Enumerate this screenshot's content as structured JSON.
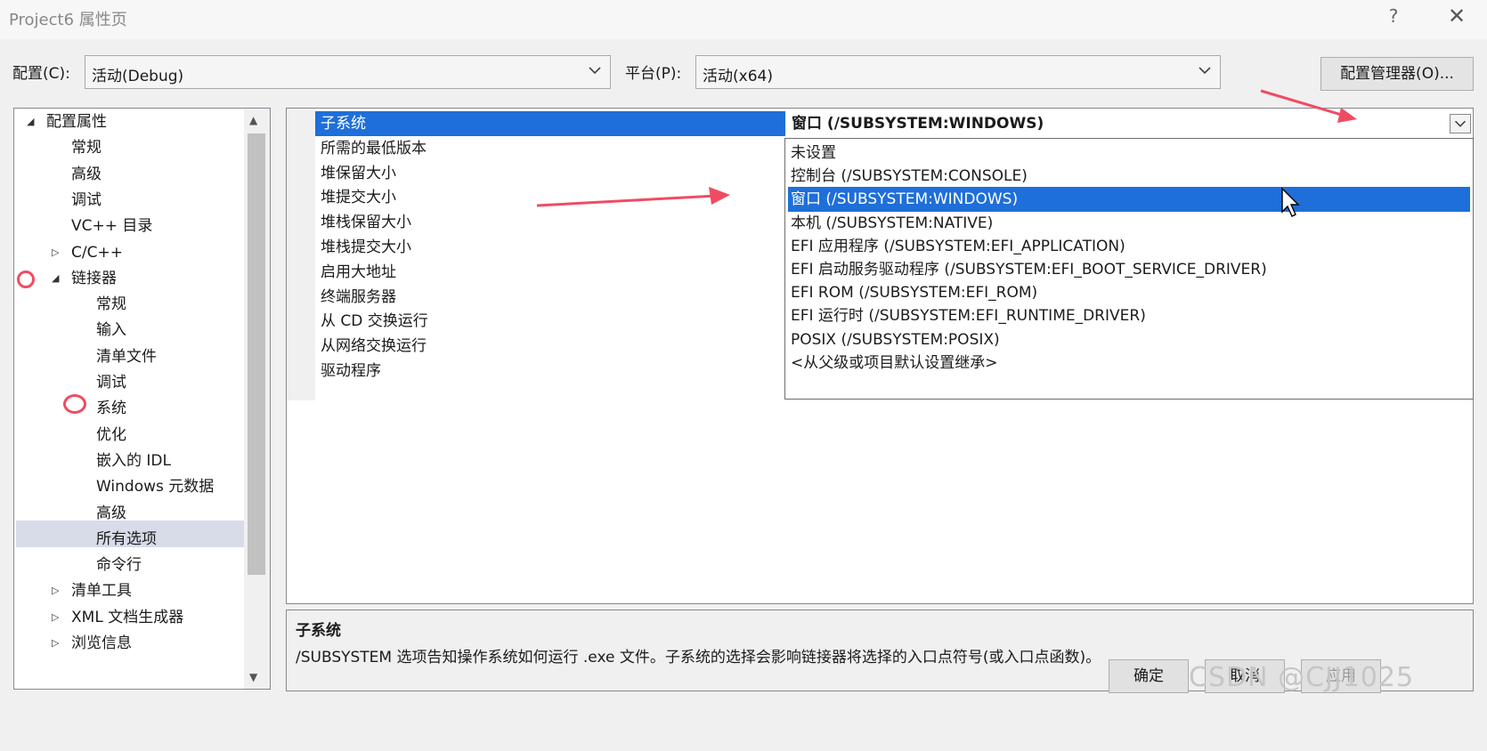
{
  "window": {
    "title": "Project6 属性页",
    "help": "?",
    "close": "✕"
  },
  "config_row": {
    "config_label": "配置(C):",
    "config_value": "活动(Debug)",
    "platform_label": "平台(P):",
    "platform_value": "活动(x64)",
    "config_manager": "配置管理器(O)..."
  },
  "tree": {
    "items": [
      {
        "label": "配置属性",
        "expander": "◢"
      },
      {
        "label": "常规"
      },
      {
        "label": "高级"
      },
      {
        "label": "调试"
      },
      {
        "label": "VC++ 目录"
      },
      {
        "label": "C/C++",
        "expander": "▷"
      },
      {
        "label": "链接器",
        "expander": "◢"
      },
      {
        "label": "常规"
      },
      {
        "label": "输入"
      },
      {
        "label": "清单文件"
      },
      {
        "label": "调试"
      },
      {
        "label": "系统"
      },
      {
        "label": "优化"
      },
      {
        "label": "嵌入的 IDL"
      },
      {
        "label": "Windows 元数据"
      },
      {
        "label": "高级"
      },
      {
        "label": "所有选项"
      },
      {
        "label": "命令行"
      },
      {
        "label": "清单工具",
        "expander": "▷"
      },
      {
        "label": "XML 文档生成器",
        "expander": "▷"
      },
      {
        "label": "浏览信息",
        "expander": "▷"
      }
    ],
    "selected_index": 11
  },
  "grid": {
    "properties": [
      "子系统",
      "所需的最低版本",
      "堆保留大小",
      "堆提交大小",
      "堆栈保留大小",
      "堆栈提交大小",
      "启用大地址",
      "终端服务器",
      "从 CD 交换运行",
      "从网络交换运行",
      "驱动程序"
    ],
    "selected_value": "窗口 (/SUBSYSTEM:WINDOWS)"
  },
  "dropdown": {
    "options": [
      "未设置",
      "控制台 (/SUBSYSTEM:CONSOLE)",
      "窗口 (/SUBSYSTEM:WINDOWS)",
      "本机 (/SUBSYSTEM:NATIVE)",
      "EFI 应用程序 (/SUBSYSTEM:EFI_APPLICATION)",
      "EFI 启动服务驱动程序 (/SUBSYSTEM:EFI_BOOT_SERVICE_DRIVER)",
      "EFI ROM (/SUBSYSTEM:EFI_ROM)",
      "EFI 运行时 (/SUBSYSTEM:EFI_RUNTIME_DRIVER)",
      "POSIX (/SUBSYSTEM:POSIX)",
      "<从父级或项目默认设置继承>"
    ],
    "highlighted_index": 2
  },
  "description": {
    "title": "子系统",
    "text": "/SUBSYSTEM 选项告知操作系统如何运行 .exe 文件。子系统的选择会影响链接器将选择的入口点符号(或入口点函数)。"
  },
  "buttons": {
    "ok": "确定",
    "cancel": "取消",
    "apply": "应用"
  },
  "watermark": "CSDN @CJJ1025",
  "colors": {
    "selection": "#1e6fd9",
    "tree_selection": "#d8dbe8",
    "annotation": "#ef4c63"
  },
  "icons": {
    "dropdown_arrow": "chevron-down-icon",
    "cursor": "mouse-pointer-icon"
  }
}
